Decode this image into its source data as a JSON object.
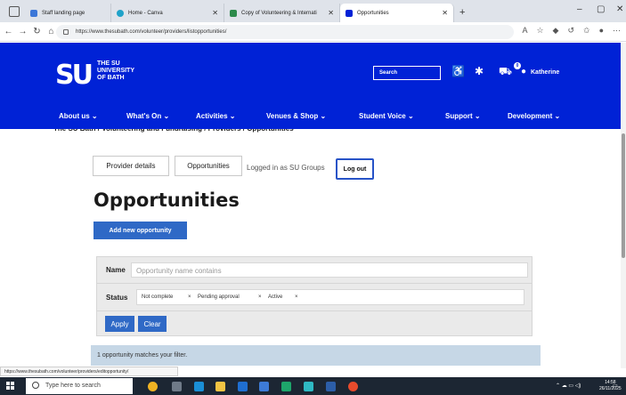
{
  "browser": {
    "tabs": [
      {
        "label": "Staff landing page",
        "fav_color": "#3c77d8"
      },
      {
        "label": "Home - Canva",
        "fav_color": "#1fa2c9"
      },
      {
        "label": "Copy of Volunteering & Internati",
        "fav_color": "#2c8a4b"
      },
      {
        "label": "Opportunities",
        "fav_color": "#0022d6"
      }
    ],
    "url": "https://www.thesubath.com/volunteer/providers/listopportunities/"
  },
  "header": {
    "logo_mark": "SU",
    "logo_line1": "THE SU",
    "logo_line2": "UNIVERSITY",
    "logo_line3": "OF BATH",
    "search_placeholder": "Search",
    "cart_count": "0",
    "user_name": "Katherine",
    "nav": [
      "About us ⌄",
      "What's On ⌄",
      "Activities ⌄",
      "Venues & Shop ⌄",
      "Student Voice ⌄",
      "Support ⌄",
      "Development ⌄"
    ]
  },
  "breadcrumb": "The SU Bath / Volunteering and Fundraising / Providers / Opportunities",
  "page": {
    "provider_details": "Provider details",
    "opportunities_tab": "Opportunities",
    "logged_in": "Logged in as SU Groups",
    "logout": "Log out",
    "title": "Opportunities",
    "add_button": "Add new opportunity"
  },
  "filter": {
    "name_label": "Name",
    "name_placeholder": "Opportunity name contains",
    "status_label": "Status",
    "status_tags": [
      "Not complete",
      "Pending approval",
      "Active"
    ],
    "apply": "Apply",
    "clear": "Clear"
  },
  "result_text": "1 opportunity matches your filter.",
  "status_url": "https://www.thesubath.com/volunteer/providers/editopportunity/",
  "taskbar": {
    "search_placeholder": "Type here to search",
    "time": "14:58",
    "date": "26/11/2025"
  }
}
